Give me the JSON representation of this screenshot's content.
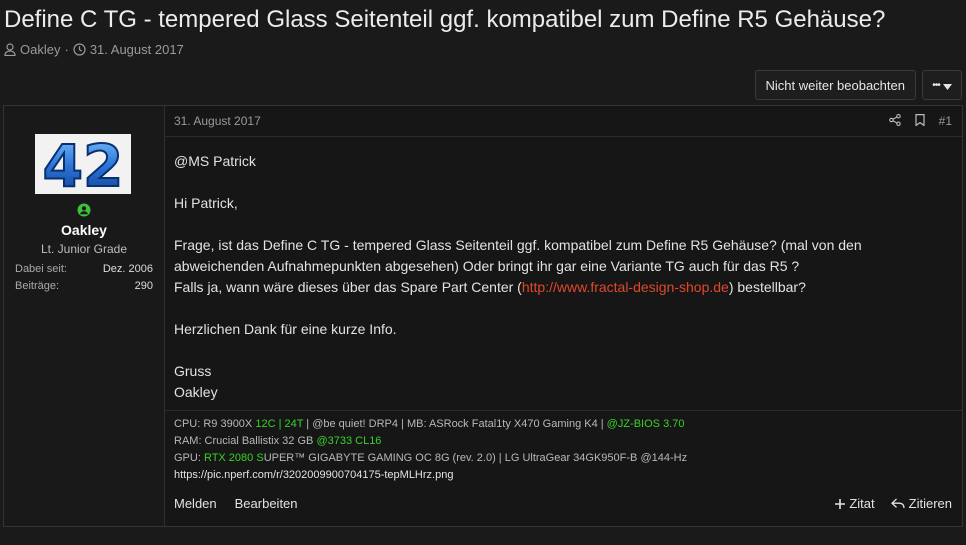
{
  "thread": {
    "title": "Define C TG - tempered Glass Seitenteil ggf. kompatibel zum Define R5 Gehäuse?",
    "author": "Oakley",
    "separator": "·",
    "date": "31. August 2017"
  },
  "actions": {
    "unwatch_label": "Nicht weiter beobachten",
    "more_label": "•••"
  },
  "post": {
    "date": "31. August 2017",
    "number": "#1",
    "user": {
      "avatar_text": "42",
      "name": "Oakley",
      "title": "Lt. Junior Grade",
      "joined_label": "Dabei seit:",
      "joined_value": "Dez. 2006",
      "posts_label": "Beiträge:",
      "posts_value": "290"
    },
    "body": {
      "line1": "@MS Patrick",
      "line2": "Hi Patrick,",
      "line3": "Frage, ist das Define C TG - tempered Glass Seitenteil ggf. kompatibel zum Define R5 Gehäuse? (mal von den abweichenden Aufnahmepunkten abgesehen) Oder bringt ihr gar eine Variante TG auch für das R5 ?",
      "line4_pre": "Falls ja, wann wäre dieses über das Spare Part Center (",
      "line4_link": "http://www.fractal-design-shop.de",
      "line4_post": ") bestellbar?",
      "line5": "Herzlichen Dank für eine kurze Info.",
      "line6": "Gruss",
      "line7": "Oakley"
    },
    "signature": {
      "cpu_a": "CPU: R9 3900X ",
      "cpu_b": "12C | 24T",
      "cpu_c": " | @be quiet! DRP4 | MB: ASRock Fatal1ty X470 Gaming K4 | ",
      "cpu_d": "@JZ-BIOS 3.70",
      "ram_a": "RAM: Crucial Ballistix 32 GB ",
      "ram_b": "@3733 CL16",
      "gpu_a": "GPU: ",
      "gpu_b": "RTX 2080 S",
      "gpu_c": "UPER™ GIGABYTE GAMING OC 8G (rev. 2.0) | LG UltraGear 34GK950F-B @144-Hz",
      "url": "https://pic.nperf.com/r/3202009900704175-tepMLHrz.png"
    },
    "footer": {
      "report": "Melden",
      "edit": "Bearbeiten",
      "quote_plus": "Zitat",
      "quote": "Zitieren"
    }
  },
  "colors": {
    "link": "#e0482b",
    "highlight": "#39d12b",
    "online": "#3cc13b"
  }
}
